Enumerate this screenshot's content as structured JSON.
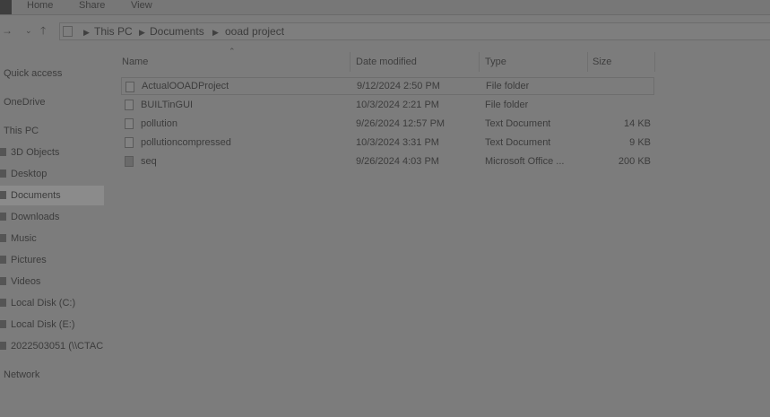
{
  "ribbon": {
    "tabs": [
      "Home",
      "Share",
      "View"
    ]
  },
  "address": {
    "back_icon": "back-arrow-icon",
    "recent_icon": "chevron-down-icon",
    "up_icon": "up-arrow-icon",
    "crumbs": [
      "This PC",
      "Documents",
      "ooad project"
    ]
  },
  "sidebar": {
    "items": [
      {
        "label": "Quick access",
        "section": true
      },
      {
        "label": "OneDrive",
        "section": true
      },
      {
        "label": "This PC",
        "section": true
      },
      {
        "label": "3D Objects"
      },
      {
        "label": "Desktop"
      },
      {
        "label": "Documents",
        "selected": true
      },
      {
        "label": "Downloads"
      },
      {
        "label": "Music"
      },
      {
        "label": "Pictures"
      },
      {
        "label": "Videos"
      },
      {
        "label": "Local Disk (C:)"
      },
      {
        "label": "Local Disk (E:)"
      },
      {
        "label": "2022503051 (\\\\CTAC"
      },
      {
        "label": "Network",
        "section": true
      }
    ]
  },
  "columns": {
    "name": "Name",
    "date": "Date modified",
    "type": "Type",
    "size": "Size"
  },
  "files": [
    {
      "name": "ActualOOADProject",
      "date": "9/12/2024 2:50 PM",
      "type": "File folder",
      "size": "",
      "icon": "folder-icon"
    },
    {
      "name": "BUILTinGUI",
      "date": "10/3/2024 2:21 PM",
      "type": "File folder",
      "size": "",
      "icon": "folder-icon"
    },
    {
      "name": "pollution",
      "date": "9/26/2024 12:57 PM",
      "type": "Text Document",
      "size": "14 KB",
      "icon": "text-file-icon"
    },
    {
      "name": "pollutioncompressed",
      "date": "10/3/2024 3:31 PM",
      "type": "Text Document",
      "size": "9 KB",
      "icon": "text-file-icon"
    },
    {
      "name": "seq",
      "date": "9/26/2024 4:03 PM",
      "type": "Microsoft Office ...",
      "size": "200 KB",
      "icon": "office-file-icon"
    }
  ]
}
